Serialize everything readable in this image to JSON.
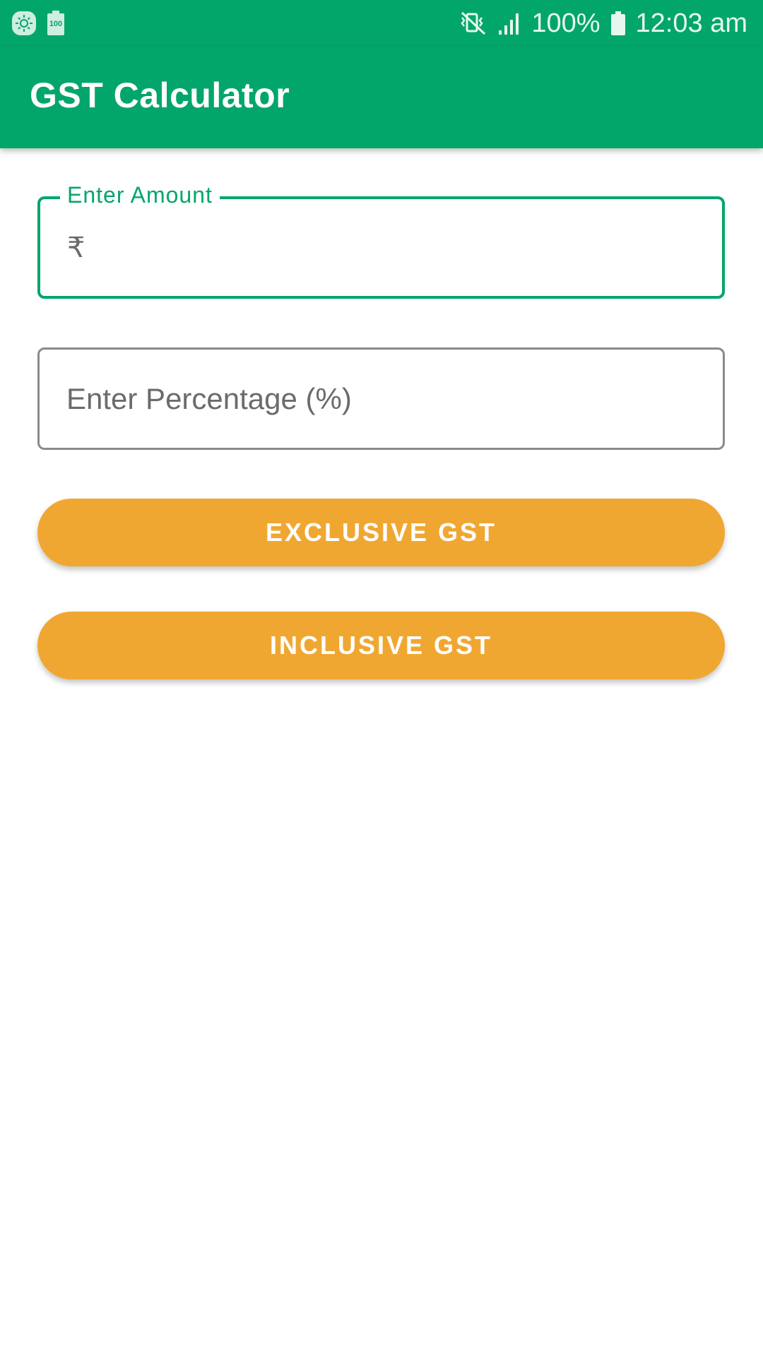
{
  "status_bar": {
    "left_icons": [
      "brightness-app-icon",
      "battery-100-icon"
    ],
    "battery_badge_text": "100",
    "right_icons": [
      "vibrate-mute-icon",
      "signal-icon",
      "battery-icon"
    ],
    "battery_percent": "100%",
    "time": "12:03 am"
  },
  "app_bar": {
    "title": "GST Calculator",
    "color": "#03a66a"
  },
  "form": {
    "amount": {
      "label": "Enter Amount",
      "prefix": "₹",
      "value": ""
    },
    "percentage": {
      "placeholder": "Enter Percentage (%)",
      "value": ""
    }
  },
  "buttons": {
    "exclusive_label": "EXCLUSIVE GST",
    "inclusive_label": "INCLUSIVE GST",
    "color": "#f0a731"
  }
}
